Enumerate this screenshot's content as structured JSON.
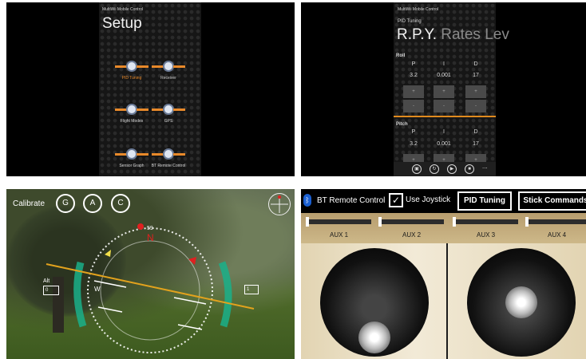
{
  "panel_setup": {
    "app_title": "MultiWii Mobile Control",
    "page_title": "Setup",
    "tiles": [
      {
        "label": "PID Tuning"
      },
      {
        "label": "Receiver"
      },
      {
        "label": "Flight Modes"
      },
      {
        "label": "GPS"
      },
      {
        "label": "Sensor Graph"
      },
      {
        "label": "BT Remote Control"
      }
    ],
    "accent_color": "#e8892a"
  },
  "panel_pid": {
    "app_title": "MultiWii Mobile Control",
    "page_title": "PID Tuning",
    "pivot_active": "R.P.Y.",
    "pivot_others": [
      "Rates",
      "Lev"
    ],
    "roll": {
      "section": "Roll",
      "headers": [
        "P",
        "I",
        "D"
      ],
      "values": [
        "3.2",
        "0.001",
        "17"
      ]
    },
    "pitch": {
      "section": "Pitch",
      "headers": [
        "P",
        "I",
        "D"
      ],
      "values": [
        "3.2",
        "0.001",
        "17"
      ]
    },
    "plus": "+",
    "minus": "-",
    "appbar_more": "..."
  },
  "panel_hud": {
    "calibrate": "Calibrate",
    "buttons": [
      "G",
      "A",
      "C"
    ],
    "heading_value": "59",
    "heading_letter": "N",
    "alt_label": "Alt",
    "alt_value": "0",
    "speed_value": "1",
    "west_label": "W"
  },
  "panel_remote": {
    "bt_label": "BT Remote Control",
    "joystick_label": "Use Joystick",
    "joystick_checked": true,
    "pid_button": "PID Tuning",
    "stick_button": "Stick Commands",
    "aux_labels": [
      "AUX 1",
      "AUX 2",
      "AUX 3",
      "AUX 4"
    ],
    "aux_values": [
      0,
      0,
      0,
      0
    ],
    "bluetooth_color": "#1a5fd1"
  }
}
